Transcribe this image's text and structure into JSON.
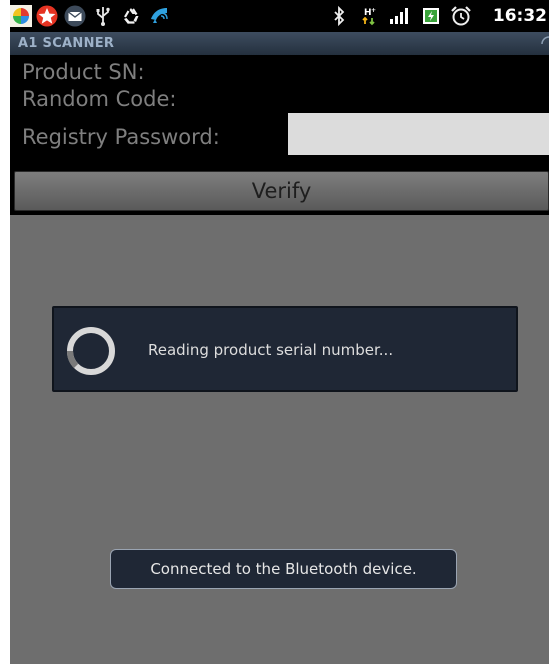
{
  "colors": {
    "background": "#6e6e6e",
    "status_bar": "#000000",
    "title_bar": "#2f3b4b",
    "title_text": "#9db1c8",
    "form_background": "#000000",
    "label_text": "#7f7f7f",
    "input_background": "#dcdcdc",
    "dialog_background": "#1f2735",
    "toast_background": "#1f2735"
  },
  "status_bar": {
    "time": "16:32",
    "icons": [
      "app-notification-icon",
      "star-icon",
      "mail-icon",
      "usb-icon",
      "recycle-icon",
      "phone-call-icon",
      "bluetooth-icon",
      "hspa-signal-icon",
      "signal-bars-icon",
      "battery-icon",
      "alarm-icon"
    ]
  },
  "title_bar": {
    "title": "A1 SCANNER"
  },
  "form": {
    "product_sn_label": "Product SN:",
    "random_code_label": "Random Code:",
    "registry_password_label": "Registry Password:",
    "registry_password_value": "",
    "verify_button_label": "Verify"
  },
  "progress_dialog": {
    "message": "Reading product serial number..."
  },
  "toast": {
    "message": "Connected to the Bluetooth device."
  }
}
